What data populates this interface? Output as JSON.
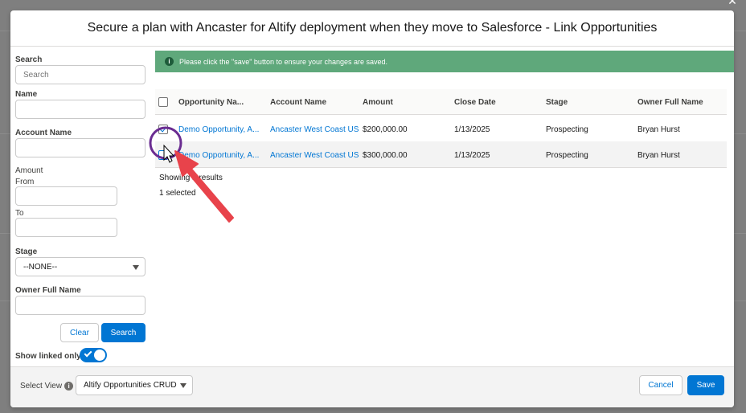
{
  "modal": {
    "title": "Secure a plan with Ancaster for Altify deployment when they move to Salesforce  - Link Opportunities"
  },
  "filters": {
    "search_label": "Search",
    "search_placeholder": "Search",
    "name_label": "Name",
    "account_label": "Account Name",
    "amount_label": "Amount",
    "from_label": "From",
    "to_label": "To",
    "stage_label": "Stage",
    "stage_value": "--NONE--",
    "owner_label": "Owner Full Name",
    "clear_label": "Clear",
    "search_button": "Search",
    "linked_only_label": "Show linked only",
    "linked_only_on": true
  },
  "banner": {
    "message": "Please click the \"save\" button to ensure your changes are saved.",
    "color": "#5fa87b"
  },
  "table": {
    "columns": [
      "Opportunity Na...",
      "Account Name",
      "Amount",
      "Close Date",
      "Stage",
      "Owner Full Name"
    ],
    "rows": [
      {
        "checked": true,
        "opportunity": "Demo Opportunity, A...",
        "account": "Ancaster West Coast US",
        "amount": "$200,000.00",
        "close_date": "1/13/2025",
        "stage": "Prospecting",
        "owner": "Bryan Hurst"
      },
      {
        "checked": false,
        "opportunity": "Demo Opportunity, A...",
        "account": "Ancaster West Coast US",
        "amount": "$300,000.00",
        "close_date": "1/13/2025",
        "stage": "Prospecting",
        "owner": "Bryan Hurst"
      }
    ],
    "results_text": "Showing 2 results",
    "selected_text": "1 selected"
  },
  "footer": {
    "select_view_label": "Select View",
    "view_value": "Altify Opportunities CRUD",
    "cancel_label": "Cancel",
    "save_label": "Save"
  },
  "colors": {
    "brand": "#0176d3",
    "annotation_arrow": "#e8434b",
    "annotation_circle": "#6a2c91"
  }
}
